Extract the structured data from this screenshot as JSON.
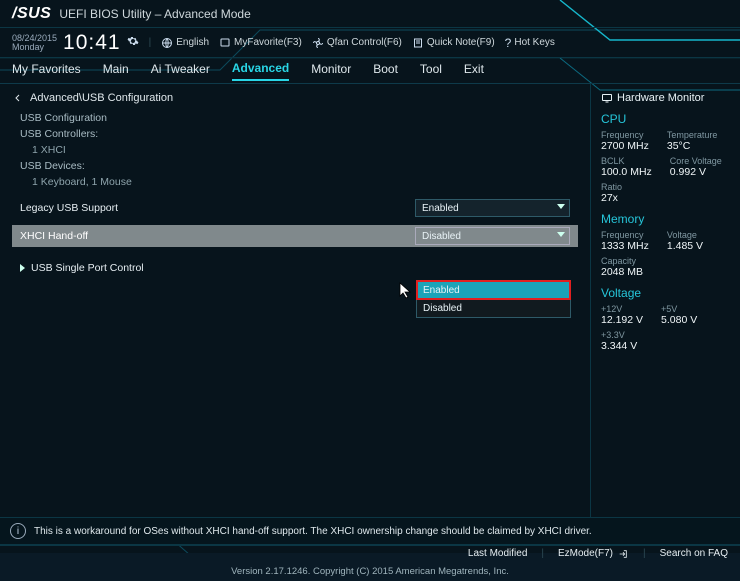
{
  "logo": "/SUS",
  "title": "UEFI BIOS Utility – Advanced Mode",
  "date": "08/24/2015",
  "day": "Monday",
  "time": "10:41",
  "toolbar": {
    "language": "English",
    "fav": "MyFavorite(F3)",
    "qfan": "Qfan Control(F6)",
    "quick": "Quick Note(F9)",
    "hot": "Hot Keys"
  },
  "tabs": [
    "My Favorites",
    "Main",
    "Ai Tweaker",
    "Advanced",
    "Monitor",
    "Boot",
    "Tool",
    "Exit"
  ],
  "active_tab": 3,
  "breadcrumb": "Advanced\\USB Configuration",
  "sections": {
    "usb_cfg": "USB Configuration",
    "usb_ctrl": "USB Controllers:",
    "xhci_count": "1 XHCI",
    "usb_dev": "USB Devices:",
    "devs": "1 Keyboard, 1 Mouse"
  },
  "rows": {
    "legacy": {
      "label": "Legacy USB Support",
      "value": "Enabled"
    },
    "xhci": {
      "label": "XHCI Hand-off",
      "value": "Disabled",
      "options": [
        "Enabled",
        "Disabled"
      ]
    },
    "single": {
      "label": "USB Single Port Control"
    }
  },
  "help": "This is a workaround for OSes without XHCI hand-off support. The XHCI ownership change should be claimed by XHCI driver.",
  "hw": {
    "title": "Hardware Monitor",
    "cpu": {
      "heading": "CPU",
      "freq_k": "Frequency",
      "freq_v": "2700 MHz",
      "temp_k": "Temperature",
      "temp_v": "35°C",
      "bclk_k": "BCLK",
      "bclk_v": "100.0 MHz",
      "cv_k": "Core Voltage",
      "cv_v": "0.992 V",
      "ratio_k": "Ratio",
      "ratio_v": "27x"
    },
    "mem": {
      "heading": "Memory",
      "freq_k": "Frequency",
      "freq_v": "1333 MHz",
      "volt_k": "Voltage",
      "volt_v": "1.485 V",
      "cap_k": "Capacity",
      "cap_v": "2048 MB"
    },
    "volt": {
      "heading": "Voltage",
      "p12_k": "+12V",
      "p12_v": "12.192 V",
      "p5_k": "+5V",
      "p5_v": "5.080 V",
      "p33_k": "+3.3V",
      "p33_v": "3.344 V"
    }
  },
  "footer": {
    "last": "Last Modified",
    "ez": "EzMode(F7)",
    "search": "Search on FAQ",
    "ver": "Version 2.17.1246. Copyright (C) 2015 American Megatrends, Inc."
  }
}
